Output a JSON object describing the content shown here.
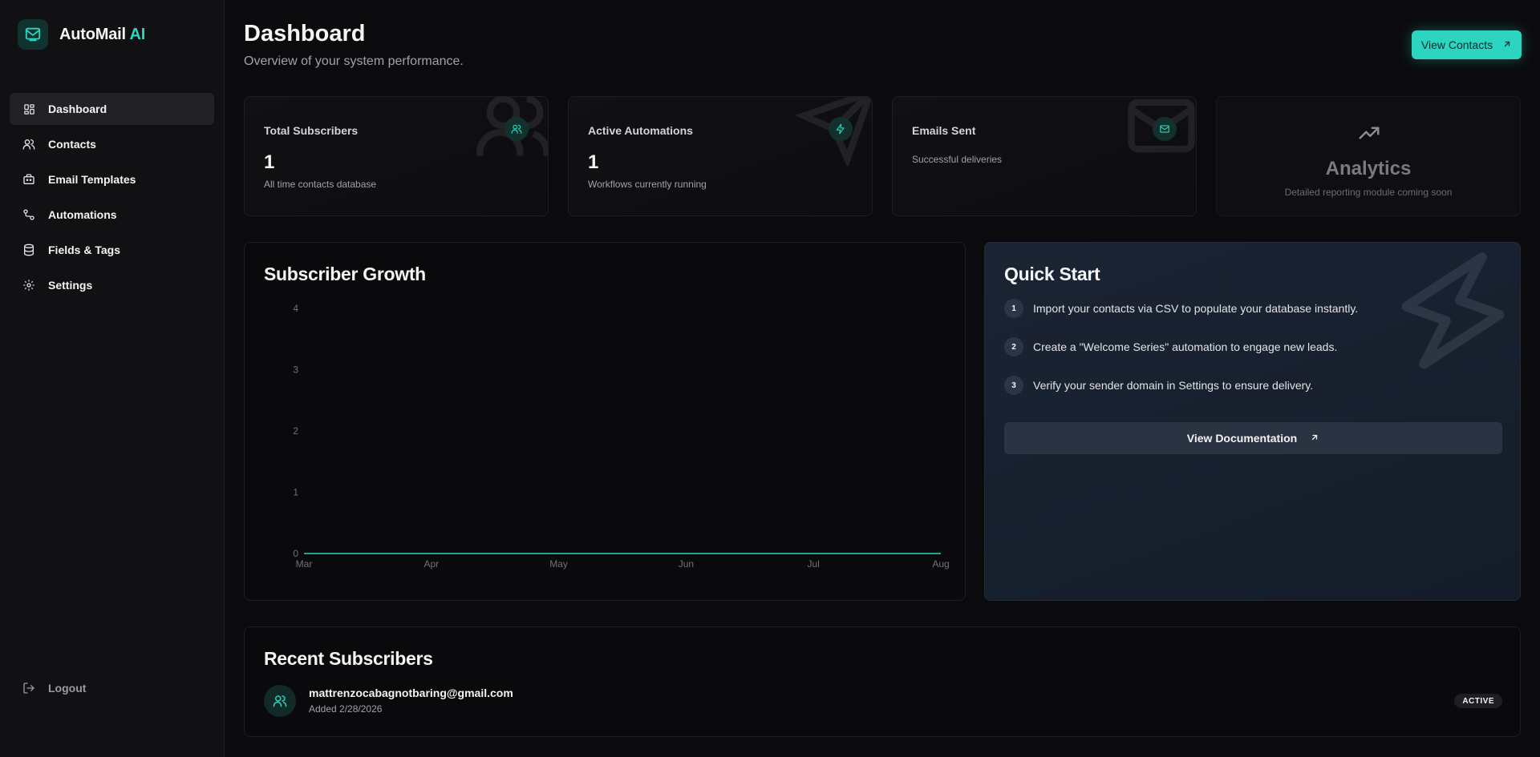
{
  "brand": {
    "name": "AutoMail",
    "accent": "AI"
  },
  "sidebar": {
    "items": [
      {
        "label": "Dashboard",
        "icon": "dashboard-icon",
        "active": true
      },
      {
        "label": "Contacts",
        "icon": "users-icon"
      },
      {
        "label": "Email Templates",
        "icon": "template-icon"
      },
      {
        "label": "Automations",
        "icon": "workflow-icon"
      },
      {
        "label": "Fields & Tags",
        "icon": "database-icon"
      },
      {
        "label": "Settings",
        "icon": "gear-icon"
      }
    ],
    "logout": "Logout"
  },
  "header": {
    "title": "Dashboard",
    "subtitle": "Overview of your system performance.",
    "view_contacts": "View Contacts"
  },
  "stats": [
    {
      "title": "Total Subscribers",
      "value": "1",
      "desc": "All time contacts database",
      "icon": "users-icon"
    },
    {
      "title": "Active Automations",
      "value": "1",
      "desc": "Workflows currently running",
      "icon": "bolt-icon"
    },
    {
      "title": "Emails Sent",
      "value": "",
      "desc": "Successful deliveries",
      "icon": "mail-icon"
    }
  ],
  "analytics": {
    "title": "Analytics",
    "desc": "Detailed reporting module coming soon",
    "icon": "trending-up-icon"
  },
  "chart_card": {
    "title": "Subscriber Growth"
  },
  "chart_data": {
    "type": "area",
    "x": [
      "Mar",
      "Apr",
      "May",
      "Jun",
      "Jul",
      "Aug"
    ],
    "series": [
      {
        "values": [
          0,
          0,
          0,
          0,
          0,
          0
        ]
      }
    ],
    "y_ticks": [
      "0",
      "1",
      "2",
      "3",
      "4"
    ],
    "ylim": [
      0,
      4
    ],
    "xlabel": "",
    "ylabel": "",
    "grid": false,
    "line_color": "#2dd4bf"
  },
  "quick_start": {
    "title": "Quick Start",
    "steps": [
      {
        "num": "1",
        "text": "Import your contacts via CSV to populate your database instantly."
      },
      {
        "num": "2",
        "text": "Create a \"Welcome Series\" automation to engage new leads."
      },
      {
        "num": "3",
        "text": "Verify your sender domain in Settings to ensure delivery."
      }
    ],
    "button": "View Documentation"
  },
  "recent": {
    "title": "Recent Subscribers",
    "rows": [
      {
        "email": "mattrenzocabagnotbaring@gmail.com",
        "date": "Added 2/28/2026",
        "status": "ACTIVE"
      }
    ]
  },
  "colors": {
    "accent": "#2dd4bf",
    "background": "#0b0b0d",
    "sidebar": "#111113",
    "quick_start_bg": "#1b2433"
  }
}
